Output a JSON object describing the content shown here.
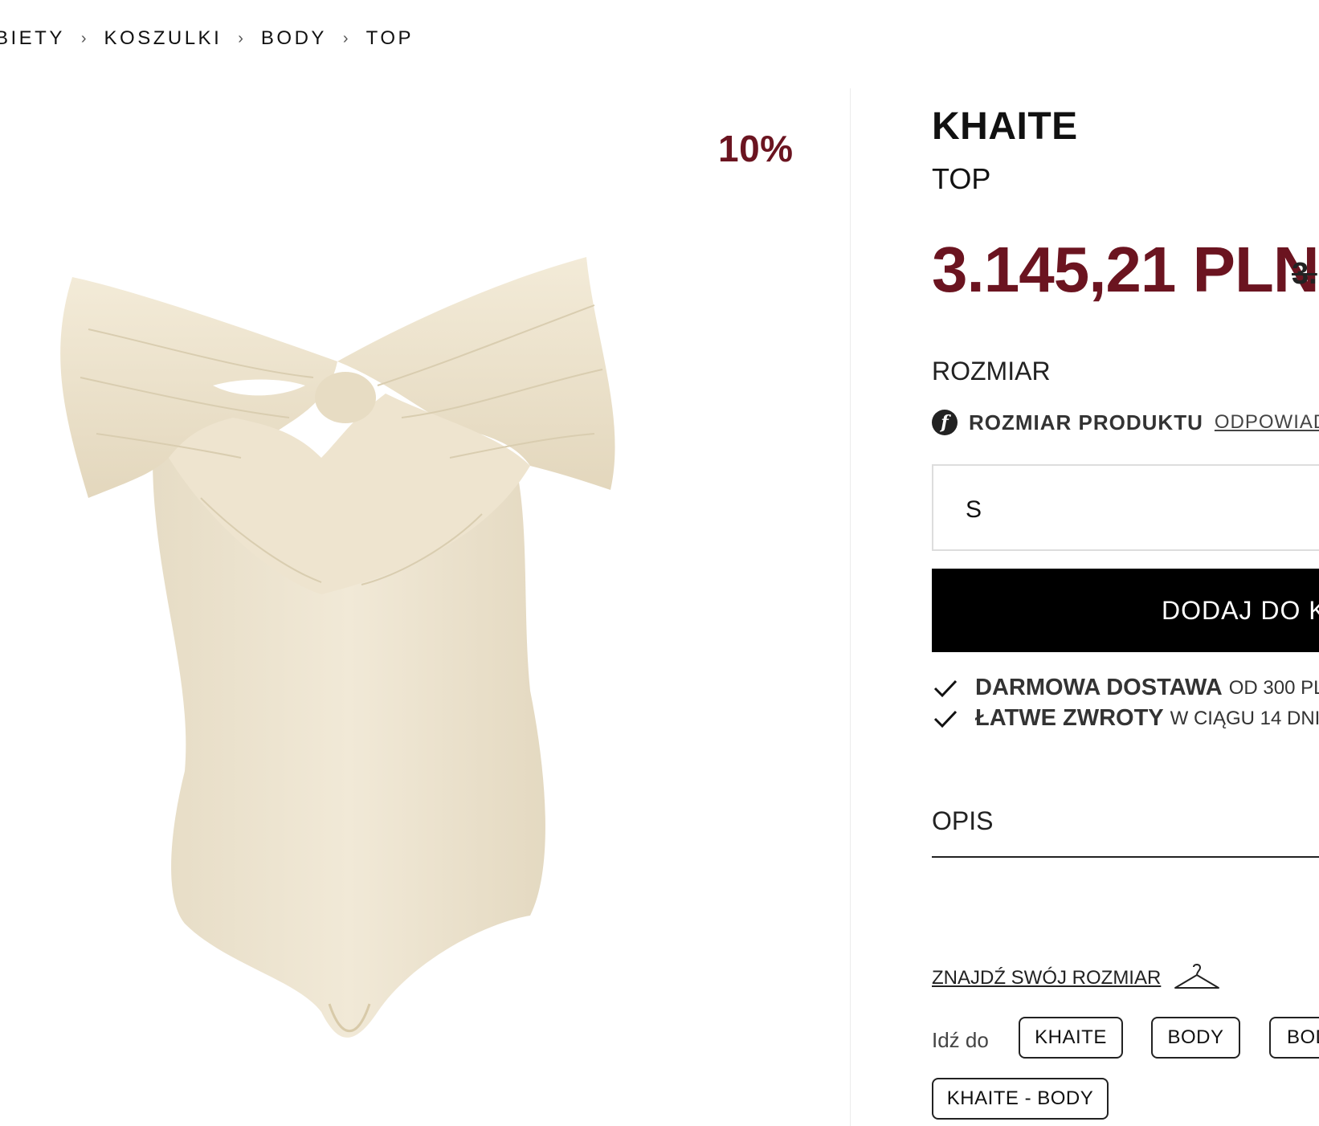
{
  "breadcrumb": {
    "items": [
      "BIETY",
      "KOSZULKI",
      "BODY",
      "TOP"
    ],
    "separator": "›"
  },
  "product": {
    "discount": "10%",
    "brand": "KHAITE",
    "name": "TOP",
    "price": "3.145,21 PLN",
    "old_price": "3.",
    "image_color": "#efe6d2"
  },
  "size": {
    "label": "ROZMIAR",
    "fit_icon": "f",
    "fit_label": "ROZMIAR PRODUKTU",
    "fit_link": "ODPOWIAD",
    "selected": "S"
  },
  "cart": {
    "add_label": "DODAJ DO K"
  },
  "benefits": [
    {
      "strong": "DARMOWA DOSTAWA",
      "normal": "OD 300 PLI"
    },
    {
      "strong": "ŁATWE ZWROTY",
      "normal": "W CIĄGU 14 DNI"
    }
  ],
  "description": {
    "label": "OPIS"
  },
  "find_size": {
    "label": "ZNAJDŹ SWÓJ ROZMIAR"
  },
  "goto": {
    "label": "Idź do",
    "chips": [
      "KHAITE",
      "BODY",
      "BOD",
      "KHAITE - BODY"
    ]
  },
  "colors": {
    "accent": "#6b1420",
    "button": "#000000"
  }
}
